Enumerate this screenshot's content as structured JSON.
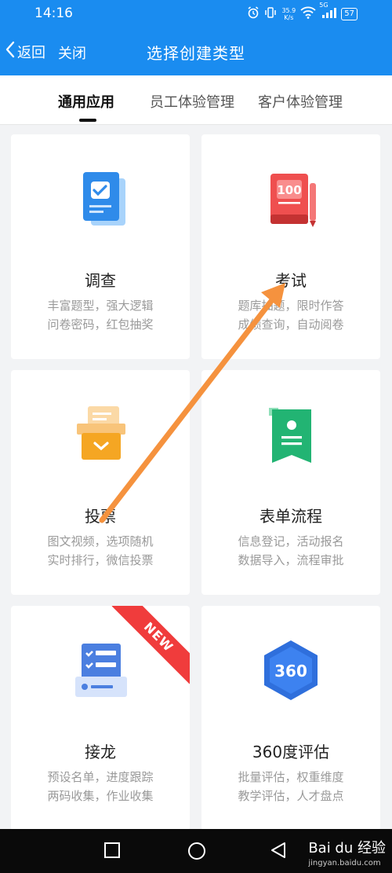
{
  "status": {
    "time": "14:16",
    "net_speed": "35.9",
    "net_unit": "K/s",
    "signal_tag": "5G",
    "battery": "57"
  },
  "nav": {
    "back_label": "返回",
    "close_label": "关闭",
    "title": "选择创建类型"
  },
  "tabs": [
    {
      "label": "通用应用",
      "active": true
    },
    {
      "label": "员工体验管理",
      "active": false
    },
    {
      "label": "客户体验管理",
      "active": false
    }
  ],
  "cards": [
    {
      "title": "调查",
      "desc1": "丰富题型，强大逻辑",
      "desc2": "问卷密码，红包抽奖",
      "icon": "survey-icon",
      "color": "#2f8bea"
    },
    {
      "title": "考试",
      "desc1": "题库抽题，限时作答",
      "desc2": "成绩查询，自动阅卷",
      "icon": "exam-100-icon",
      "color": "#ef4f4f"
    },
    {
      "title": "投票",
      "desc1": "图文视频，选项随机",
      "desc2": "实时排行，微信投票",
      "icon": "vote-box-icon",
      "color": "#f5a623"
    },
    {
      "title": "表单流程",
      "desc1": "信息登记，活动报名",
      "desc2": "数据导入，流程审批",
      "icon": "form-icon",
      "color": "#22b473"
    },
    {
      "title": "接龙",
      "desc1": "预设名单，进度跟踪",
      "desc2": "两码收集，作业收集",
      "icon": "relay-list-icon",
      "color": "#4b7fe0",
      "badge": "NEW"
    },
    {
      "title": "360度评估",
      "desc1": "批量评估，权重维度",
      "desc2": "教学评估，人才盘点",
      "icon": "360-hexagon-icon",
      "color": "#2f6fdc",
      "icon_text": "360"
    }
  ],
  "watermark": {
    "brand": "Bai du 经验",
    "url": "jingyan.baidu.com"
  }
}
